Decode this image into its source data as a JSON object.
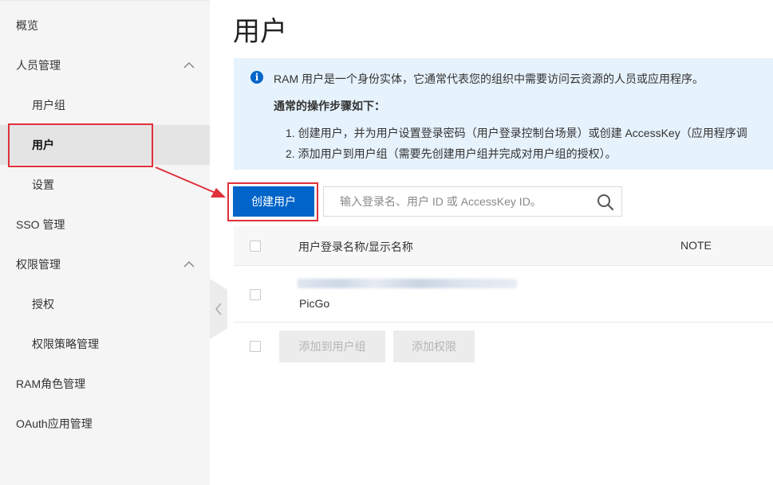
{
  "sidebar": {
    "items": [
      {
        "label": "概览"
      },
      {
        "label": "人员管理"
      },
      {
        "label": "用户组"
      },
      {
        "label": "用户"
      },
      {
        "label": "设置"
      },
      {
        "label": "SSO 管理"
      },
      {
        "label": "权限管理"
      },
      {
        "label": "授权"
      },
      {
        "label": "权限策略管理"
      },
      {
        "label": "RAM角色管理"
      },
      {
        "label": "OAuth应用管理"
      }
    ]
  },
  "main": {
    "title": "用户",
    "info": {
      "line1": "RAM 用户是一个身份实体，它通常代表您的组织中需要访问云资源的人员或应用程序。",
      "steps_title": "通常的操作步骤如下：",
      "step1": "1. 创建用户，并为用户设置登录密码（用户登录控制台场景）或创建 AccessKey（应用程序调",
      "step2": "2. 添加用户到用户组（需要先创建用户组并完成对用户组的授权）。"
    },
    "create_button": "创建用户",
    "search_placeholder": "输入登录名、用户 ID 或 AccessKey ID。",
    "table": {
      "columns": [
        "用户登录名称/显示名称",
        "NOTE"
      ],
      "rows": [
        {
          "display_name": "PicGo"
        }
      ]
    },
    "batch": {
      "add_to_group": "添加到用户组",
      "add_permission": "添加权限"
    }
  },
  "colors": {
    "primary": "#0064c8",
    "info_bg": "#e6f2fc",
    "annotation": "#e0303a",
    "sidebar_bg": "#f5f5f5"
  }
}
